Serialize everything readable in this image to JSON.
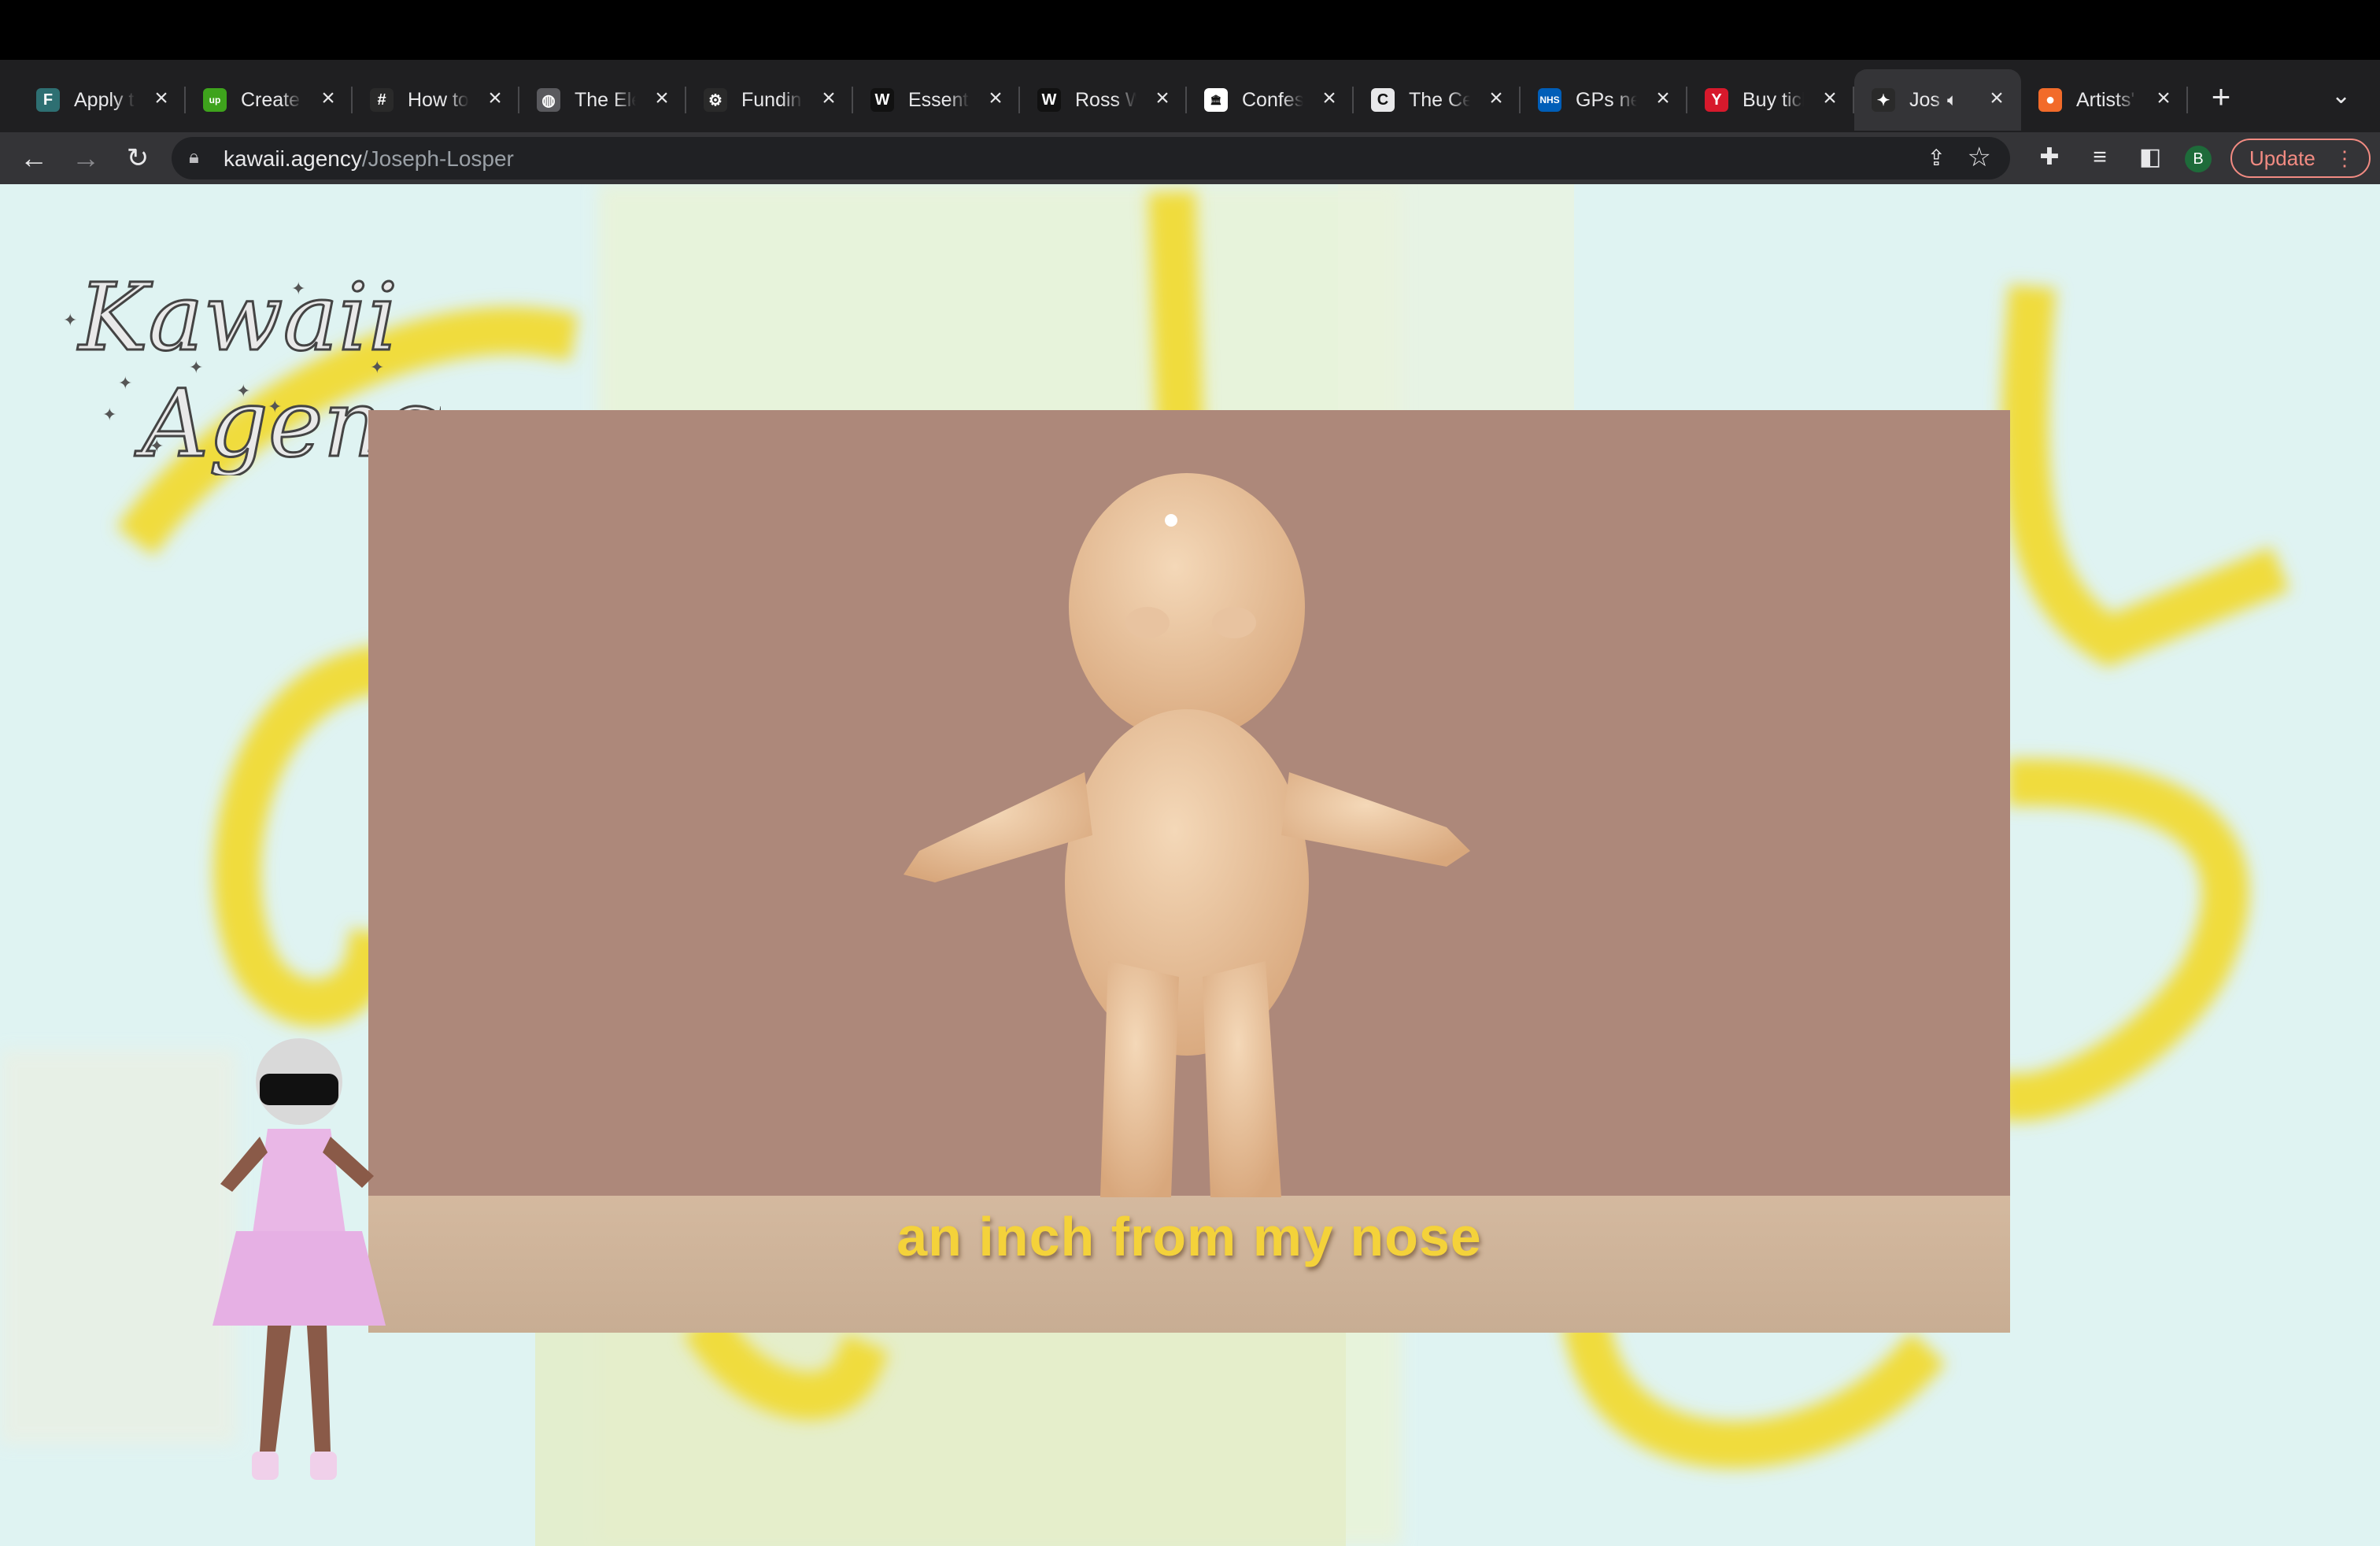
{
  "browser": {
    "tabs": [
      {
        "title": "Apply to",
        "icon": "f-letter-icon",
        "color": "#2e6f72",
        "glyph": "F"
      },
      {
        "title": "Create y",
        "icon": "upwork-icon",
        "color": "#3ea31c",
        "glyph": "up"
      },
      {
        "title": "How to",
        "icon": "hashtag-icon",
        "color": "#2a2a2a",
        "glyph": "#"
      },
      {
        "title": "The Ele",
        "icon": "globe-icon",
        "color": "#5a5a5e",
        "glyph": "◍"
      },
      {
        "title": "Funding",
        "icon": "gear-icon",
        "color": "#2a2a2a",
        "glyph": "⚙"
      },
      {
        "title": "Essenti",
        "icon": "w-letter-icon",
        "color": "#111111",
        "glyph": "W"
      },
      {
        "title": "Ross W",
        "icon": "w-letter-icon",
        "color": "#111111",
        "glyph": "W"
      },
      {
        "title": "Confess",
        "icon": "museum-icon",
        "color": "#ffffff",
        "glyph": "🏛"
      },
      {
        "title": "The Ce",
        "icon": "c-logo-icon",
        "color": "#e8e8ea",
        "glyph": "C"
      },
      {
        "title": "GPs ne",
        "icon": "nhs-icon",
        "color": "#005eb8",
        "glyph": "NHS"
      },
      {
        "title": "Buy tick",
        "icon": "y-letter-icon",
        "color": "#d7192c",
        "glyph": "Y"
      },
      {
        "title": "Jos",
        "icon": "kawaii-icon",
        "color": "#2a2a2a",
        "glyph": "✦",
        "active": true,
        "audio": true
      },
      {
        "title": "Artists'",
        "icon": "brave-icon",
        "color": "#f26b2a",
        "glyph": "●"
      }
    ],
    "url_domain": "kawaii.agency",
    "url_path": "/Joseph-Losper",
    "profile_initial": "B",
    "update_label": "Update"
  },
  "page": {
    "logo_line1": "Kawaii",
    "logo_line2": "Agency",
    "caption": "an inch from my nose"
  }
}
